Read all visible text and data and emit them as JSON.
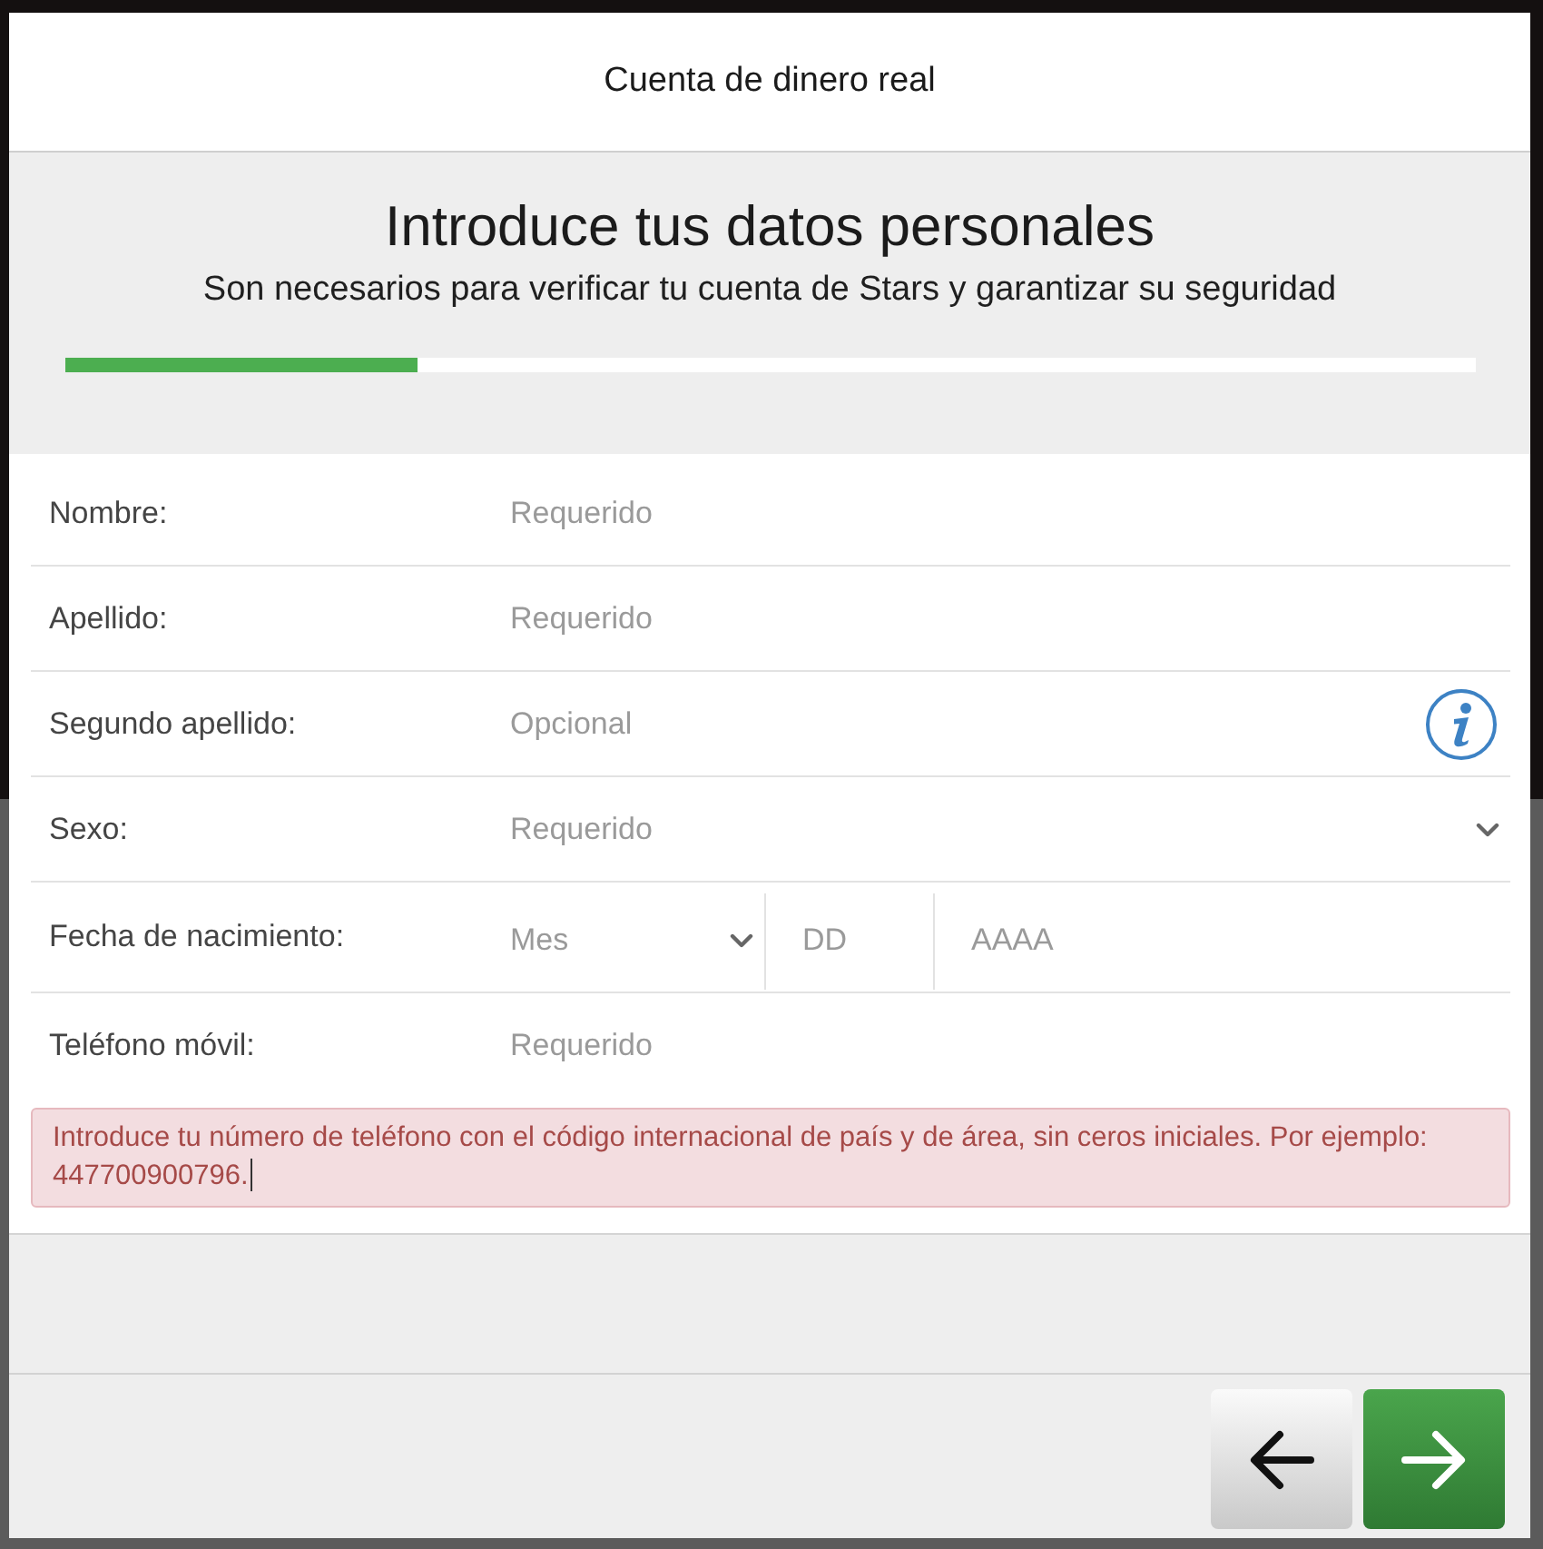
{
  "dialog": {
    "title": "Cuenta de dinero real"
  },
  "intro": {
    "heading": "Introduce tus datos personales",
    "subheading": "Son necesarios para verificar tu cuenta de Stars y garantizar su seguridad"
  },
  "progress": {
    "level": 0.25
  },
  "fields": [
    {
      "kind": "text",
      "label": "Nombre:",
      "placeholder": "Requerido"
    },
    {
      "kind": "text",
      "label": "Apellido:",
      "placeholder": "Requerido"
    },
    {
      "kind": "text",
      "label": "Segundo apellido:",
      "placeholder": "Opcional",
      "info": true
    },
    {
      "kind": "select",
      "label": "Sexo:",
      "placeholder": "Requerido"
    },
    {
      "kind": "date",
      "label": "Fecha de nacimiento:",
      "parts": [
        {
          "kind": "select",
          "placeholder": "Mes"
        },
        {
          "kind": "text",
          "placeholder": "DD"
        },
        {
          "kind": "text",
          "placeholder": "AAAA"
        }
      ]
    },
    {
      "kind": "text",
      "label": "Teléfono móvil:",
      "placeholder": "Requerido",
      "error": "Introduce tu número de teléfono con el código internacional de país y de área, sin ceros iniciales. Por ejemplo: 447700900796."
    }
  ],
  "buttons": [
    {
      "kind": "back"
    },
    {
      "kind": "next"
    }
  ]
}
